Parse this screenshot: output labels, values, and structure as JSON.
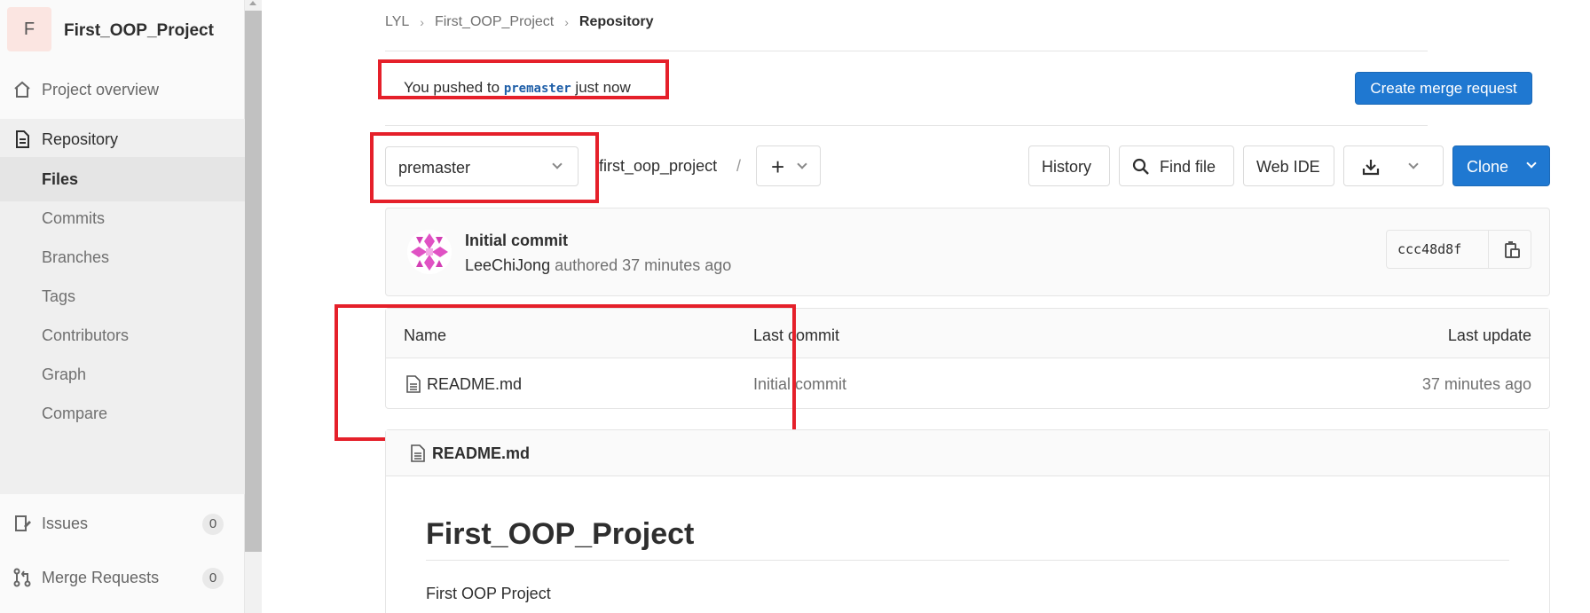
{
  "sidebar": {
    "project_initial": "F",
    "project_name": "First_OOP_Project",
    "items": [
      {
        "label": "Project overview",
        "icon": "home-icon"
      },
      {
        "label": "Repository",
        "icon": "document-icon"
      },
      {
        "label": "Issues",
        "icon": "issues-icon",
        "count": "0"
      },
      {
        "label": "Merge Requests",
        "icon": "merge-request-icon",
        "count": "0"
      }
    ],
    "repo_sub": [
      "Files",
      "Commits",
      "Branches",
      "Tags",
      "Contributors",
      "Graph",
      "Compare"
    ]
  },
  "breadcrumb": [
    "LYL",
    "First_OOP_Project",
    "Repository"
  ],
  "push_banner": {
    "prefix": "You pushed to",
    "branch": "premaster",
    "suffix": "just now",
    "button": "Create merge request"
  },
  "toolbar": {
    "branch": "premaster",
    "path": "first_oop_project",
    "path_sep": "/",
    "add": "+",
    "history": "History",
    "find_file": "Find file",
    "web_ide": "Web IDE",
    "clone": "Clone"
  },
  "commit": {
    "title": "Initial commit",
    "author": "LeeChiJong",
    "meta": "authored 37 minutes ago",
    "sha": "ccc48d8f"
  },
  "tree": {
    "headers": [
      "Name",
      "Last commit",
      "Last update"
    ],
    "rows": [
      {
        "name": "README.md",
        "last_commit": "Initial commit",
        "last_update": "37 minutes ago"
      }
    ]
  },
  "readme": {
    "file": "README.md",
    "heading": "First_OOP_Project",
    "body": "First OOP Project"
  },
  "colors": {
    "accent": "#1f78d1",
    "highlight": "#e5202a"
  }
}
